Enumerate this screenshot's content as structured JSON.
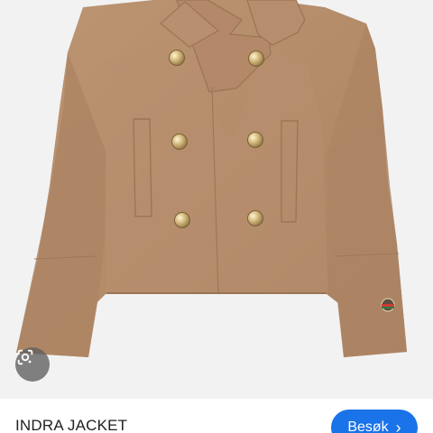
{
  "product": {
    "title": "INDRA JACKET"
  },
  "actions": {
    "visit_label": "Besøk",
    "visit_chevron": "›"
  },
  "icons": {
    "lens": "google-lens-icon"
  },
  "colors": {
    "jacket": "#b58f6f",
    "button_blue": "#1a73e8",
    "photo_bg": "#f2f2f2"
  }
}
